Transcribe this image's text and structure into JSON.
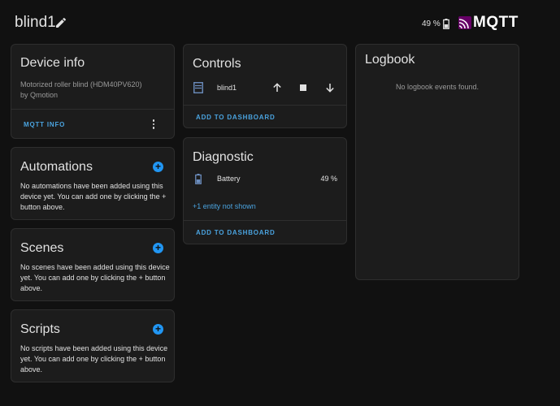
{
  "header": {
    "title": "blind1",
    "battery": "49 %",
    "brand": "MQTT"
  },
  "device_info": {
    "title": "Device info",
    "model": "Motorized roller blind (HDM40PV620)",
    "manufacturer": "by Qmotion",
    "action": "MQTT INFO"
  },
  "automations": {
    "title": "Automations",
    "lines": [
      "No automations have been added using this",
      "device yet. You can add one by clicking the +",
      "button above."
    ]
  },
  "scenes": {
    "title": "Scenes",
    "lines": [
      "No scenes have been added using this device",
      "yet. You can add one by clicking the + button",
      "above."
    ]
  },
  "scripts": {
    "title": "Scripts",
    "lines": [
      "No scripts have been added using this device",
      "yet. You can add one by clicking the + button",
      "above."
    ]
  },
  "controls": {
    "title": "Controls",
    "entity_name": "blind1",
    "action": "ADD TO DASHBOARD"
  },
  "diagnostic": {
    "title": "Diagnostic",
    "entity_name": "Battery",
    "entity_value": "49 %",
    "hidden_link": "+1 entity not shown",
    "action": "ADD TO DASHBOARD"
  },
  "logbook": {
    "title": "Logbook",
    "empty": "No logbook events found."
  },
  "colors": {
    "background": "#111111",
    "card": "#1c1c1c",
    "accent": "#2196f3",
    "link": "#4aa3df",
    "mqtt_brand": "#660066"
  }
}
